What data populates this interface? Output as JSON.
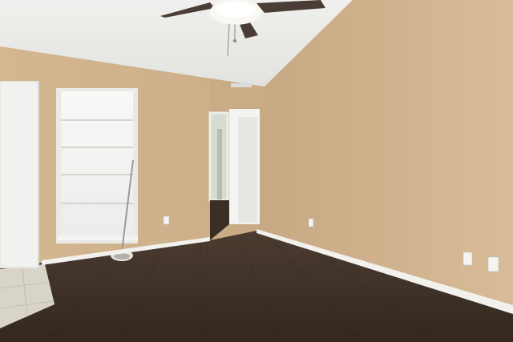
{
  "scene": {
    "subject": "empty-room",
    "colors": {
      "ceiling": "#ebebe9",
      "wall_left": "#d2b48f",
      "wall_right": "#cfb28c",
      "floor": "#3f3228",
      "baseboard": "#f2f1ee",
      "window_glass": "#f4f5f3",
      "door": "#f1f1ef",
      "fan_blade": "#4a3d35"
    },
    "elements": {
      "ceiling_fan": "ceiling-fan-icon",
      "window": "window",
      "mop": "mop",
      "outlets": 4
    }
  }
}
